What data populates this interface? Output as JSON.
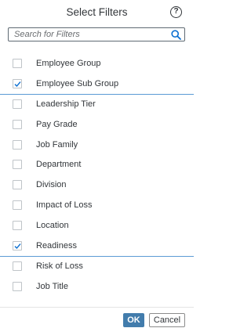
{
  "dialog": {
    "title": "Select Filters",
    "help_glyph": "?"
  },
  "search": {
    "placeholder": "Search for Filters",
    "value": ""
  },
  "filters": [
    {
      "label": "Employee Group",
      "checked": false
    },
    {
      "label": "Employee Sub Group",
      "checked": true
    },
    {
      "label": "Leadership Tier",
      "checked": false
    },
    {
      "label": "Pay Grade",
      "checked": false
    },
    {
      "label": "Job Family",
      "checked": false
    },
    {
      "label": "Department",
      "checked": false
    },
    {
      "label": "Division",
      "checked": false
    },
    {
      "label": "Impact of Loss",
      "checked": false
    },
    {
      "label": "Location",
      "checked": false
    },
    {
      "label": "Readiness",
      "checked": true
    },
    {
      "label": "Risk of Loss",
      "checked": false
    },
    {
      "label": "Job Title",
      "checked": false
    }
  ],
  "footer": {
    "ok_label": "OK",
    "cancel_label": "Cancel"
  },
  "colors": {
    "accent": "#427cac",
    "selected_line": "#5b9bd5",
    "checkmark": "#0a6ed1",
    "text": "#32363a"
  },
  "icons": {
    "help": "question-circle-icon",
    "search": "magnifier-icon",
    "check": "checkmark-icon"
  }
}
